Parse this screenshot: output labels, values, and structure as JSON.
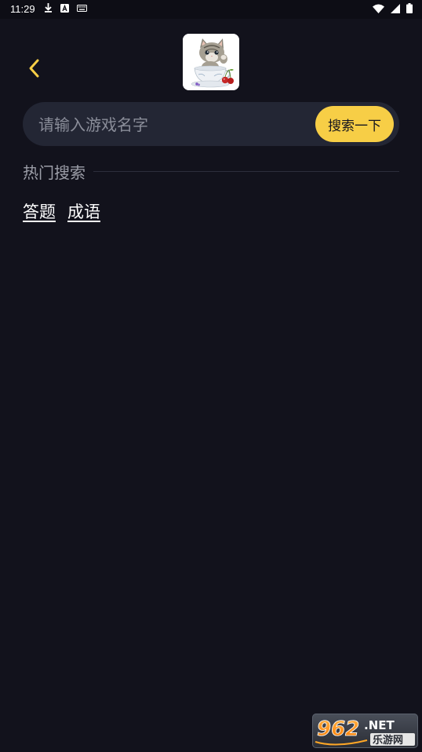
{
  "status_bar": {
    "time": "11:29",
    "left_icons": [
      "download-icon",
      "a-box-icon",
      "keyboard-icon"
    ],
    "right_icons": [
      "wifi-icon",
      "signal-icon",
      "battery-icon"
    ]
  },
  "header": {
    "back_icon": "chevron-left-icon",
    "logo": "kitten-in-teacup-logo"
  },
  "search": {
    "placeholder": "请输入游戏名字",
    "value": "",
    "button_label": "搜索一下"
  },
  "hot_search": {
    "title": "热门搜索",
    "tags": [
      "答题",
      "成语"
    ]
  },
  "watermark": {
    "brand": "962.NET",
    "subtitle": "乐游网"
  },
  "colors": {
    "background": "#12121c",
    "accent": "#f7ce46",
    "search_bg": "#232634"
  }
}
